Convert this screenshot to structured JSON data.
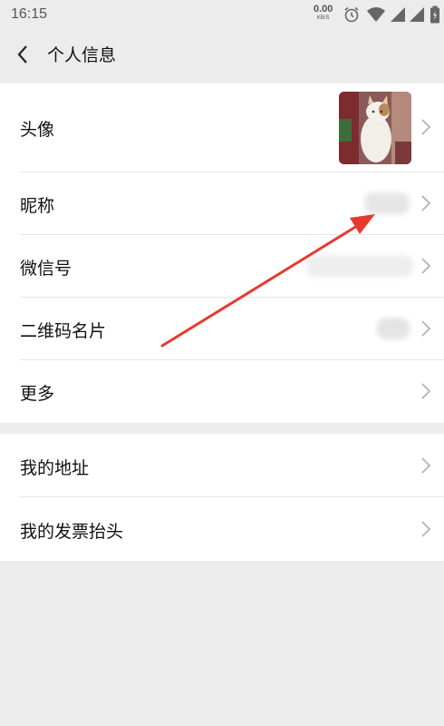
{
  "status_bar": {
    "time": "16:15",
    "net_speed_value": "0.00",
    "net_speed_unit": "KB/S",
    "icons": [
      "alarm-icon",
      "wifi-icon",
      "signal-icon",
      "signal-icon",
      "battery-icon"
    ]
  },
  "header": {
    "title": "个人信息",
    "back_icon": "chevron-left-icon"
  },
  "profile_rows": [
    {
      "label": "头像",
      "value": "avatar-image"
    },
    {
      "label": "昵称",
      "value": "blurred"
    },
    {
      "label": "微信号",
      "value": "blurred"
    },
    {
      "label": "二维码名片",
      "value": "blurred"
    },
    {
      "label": "更多"
    }
  ],
  "extra_rows": [
    {
      "label": "我的地址"
    },
    {
      "label": "我的发票抬头"
    }
  ],
  "colors": {
    "background": "#ededed",
    "row_background": "#ffffff",
    "annotation_arrow": "#e8392f",
    "chevron": "#b3b3b3"
  }
}
